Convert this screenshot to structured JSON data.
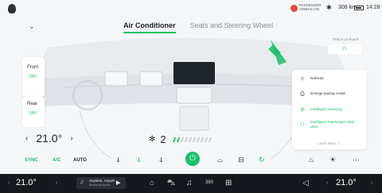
{
  "status": {
    "airbag_text": "PASSENGER AIRBAG ON",
    "range": "308 km",
    "time": "14:28"
  },
  "tabs": [
    {
      "label": "Air Conditioner",
      "active": true
    },
    {
      "label": "Seats and Steering Wheel",
      "active": false
    }
  ],
  "zones": {
    "front": {
      "label": "Front",
      "state": "ON"
    },
    "rear": {
      "label": "Rear",
      "state": "ON"
    }
  },
  "climate": {
    "driver_temp": "21.0°",
    "fan_speed": "2",
    "fan_level_of_10": 2,
    "sync_label": "SYNC",
    "ac_label": "A/C",
    "auto_label": "AUTO"
  },
  "pm25": {
    "label": "PM2.5 on-board",
    "value": "21"
  },
  "panel": {
    "items": [
      {
        "label": "Refresh",
        "icon": "refresh-icon",
        "active": false
      },
      {
        "label": "Energy-saving mode",
        "icon": "energy-saving-icon",
        "active": false
      },
      {
        "label": "Intelligent cleaning",
        "icon": "cleaning-icon",
        "active": true
      },
      {
        "label": "Intelligent Passenger Side Vent",
        "icon": "vent-icon",
        "active": true
      }
    ],
    "learn_more": "Learn More ⓘ"
  },
  "dock": {
    "left_temp": "21.0°",
    "right_temp": "21.0°",
    "music_title": "Anytime, Anywh",
    "music_subtitle": "Bluetooth Audio"
  },
  "colors": {
    "accent": "#18c066",
    "dock_bg": "#15181c",
    "panel_bg": "#ffffff"
  }
}
